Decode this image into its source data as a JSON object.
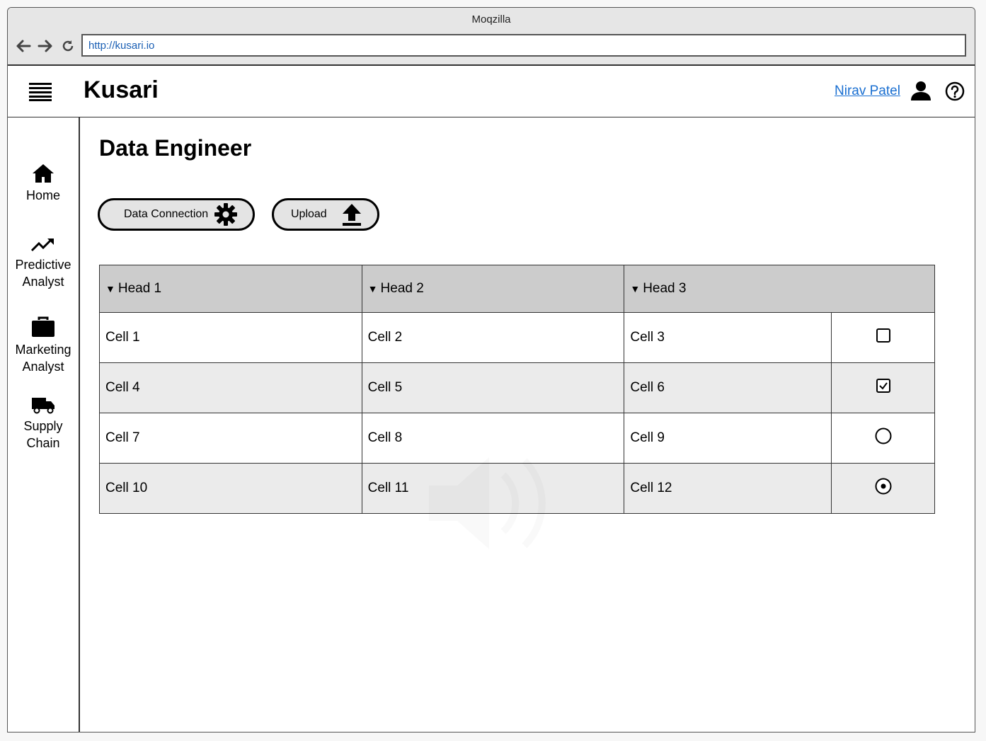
{
  "browser": {
    "title": "Moqzilla",
    "url": "http://kusari.io"
  },
  "header": {
    "app_name": "Kusari",
    "user_name": "Nirav Patel"
  },
  "sidebar": {
    "items": [
      {
        "label_line1": "Home",
        "label_line2": "",
        "icon": "home-icon"
      },
      {
        "label_line1": "Predictive",
        "label_line2": "Analyst",
        "icon": "trending-up-icon"
      },
      {
        "label_line1": "Marketing",
        "label_line2": "Analyst",
        "icon": "briefcase-icon"
      },
      {
        "label_line1": "Supply",
        "label_line2": "Chain",
        "icon": "truck-icon"
      }
    ]
  },
  "main": {
    "title": "Data Engineer",
    "buttons": {
      "data_connection": "Data Connection",
      "upload": "Upload"
    },
    "table": {
      "headers": [
        "Head 1",
        "Head 2",
        "Head 3"
      ],
      "rows": [
        {
          "cells": [
            "Cell 1",
            "Cell 2",
            "Cell 3"
          ],
          "control": "checkbox",
          "checked": false
        },
        {
          "cells": [
            "Cell 4",
            "Cell 5",
            "Cell 6"
          ],
          "control": "checkbox",
          "checked": true
        },
        {
          "cells": [
            "Cell 7",
            "Cell 8",
            "Cell 9"
          ],
          "control": "radio",
          "checked": false
        },
        {
          "cells": [
            "Cell 10",
            "Cell 11",
            "Cell 12"
          ],
          "control": "radio",
          "checked": true
        }
      ]
    }
  }
}
